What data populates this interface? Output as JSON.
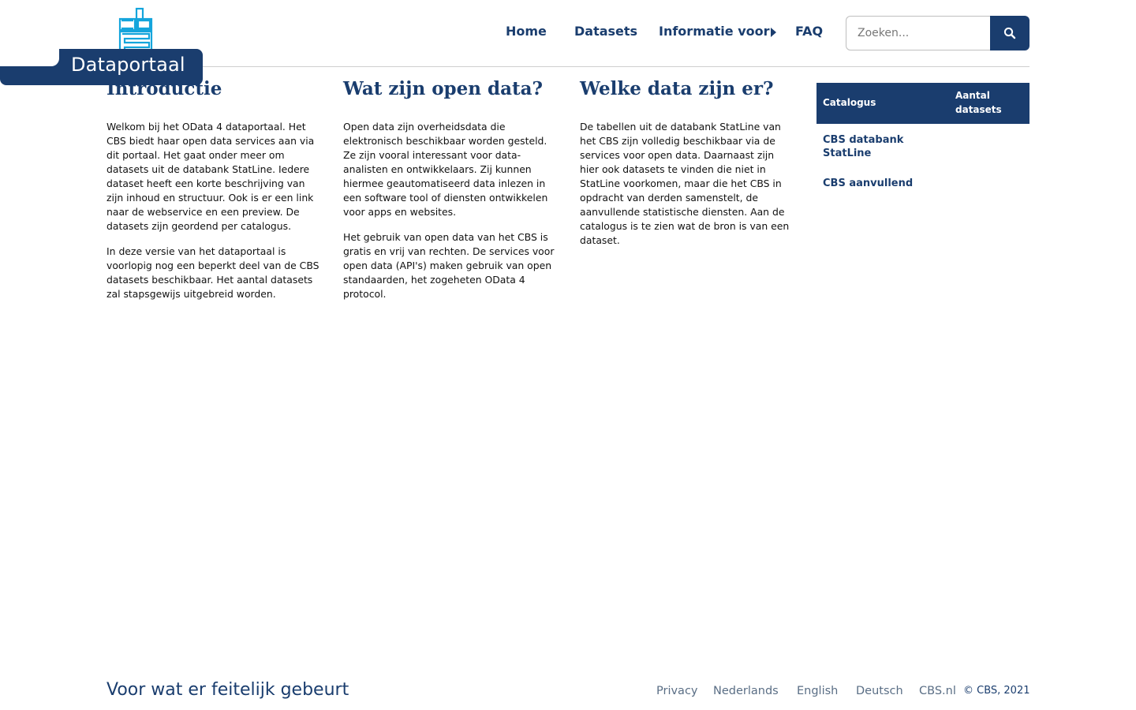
{
  "header": {
    "brand_label": "Dataportaal",
    "logo_icon": "cbs-logo-icon",
    "nav": [
      {
        "label": "Home"
      },
      {
        "label": "Datasets"
      },
      {
        "label": "Informatie voor"
      },
      {
        "label": "FAQ"
      }
    ],
    "search": {
      "placeholder": "Zoeken...",
      "value": "",
      "icon": "search-icon"
    }
  },
  "main": {
    "columns": [
      {
        "title": "Introductie",
        "paragraphs": [
          "Welkom bij het OData 4 dataportaal. Het CBS biedt haar open data services aan via dit portaal. Het gaat onder meer om datasets uit de databank StatLine. Iedere dataset heeft een korte beschrijving van zijn inhoud en structuur. Ook is er een link naar de webservice en een preview. De datasets zijn geordend per catalogus.",
          "In deze versie van het dataportaal is voorlopig nog een beperkt deel van de CBS datasets beschikbaar. Het aantal datasets zal stapsgewijs uitgebreid worden."
        ]
      },
      {
        "title": "Wat zijn open data?",
        "paragraphs": [
          "Open data zijn overheidsdata die elektronisch beschikbaar worden gesteld. Ze zijn vooral interessant voor data-analisten en ontwikkelaars. Zij kunnen hiermee geautomatiseerd data inlezen in een software tool of diensten ontwikkelen voor apps en websites.",
          "Het gebruik van open data van het CBS is gratis en vrij van rechten. De services voor open data (API's) maken gebruik van open standaarden, het zogeheten OData 4 protocol."
        ]
      },
      {
        "title": "Welke data zijn er?",
        "paragraphs": [
          "De tabellen uit de databank StatLine van het CBS zijn volledig beschikbaar via de services voor open data. Daarnaast zijn hier ook datasets te vinden die niet in StatLine voorkomen, maar die het CBS in opdracht van derden samenstelt, de aanvullende statistische diensten. Aan de catalogus is te zien wat de bron is van een dataset."
        ]
      }
    ],
    "catalog_table": {
      "headers": [
        "Catalogus",
        "Aantal datasets"
      ],
      "rows": [
        {
          "catalogus": "CBS databank StatLine",
          "aantal": ""
        },
        {
          "catalogus": "CBS aanvullend",
          "aantal": ""
        }
      ]
    }
  },
  "footer": {
    "slogan": "Voor wat er feitelijk gebeurt",
    "links": [
      {
        "label": "Privacy"
      },
      {
        "label": "Nederlands"
      },
      {
        "label": "English"
      },
      {
        "label": "Deutsch"
      },
      {
        "label": "CBS.nl"
      }
    ],
    "copyright": "© CBS, 2021"
  },
  "colors": {
    "brand": "#1a3d6e",
    "logo": "#14a5dc",
    "footer_link": "#5a6e85"
  }
}
